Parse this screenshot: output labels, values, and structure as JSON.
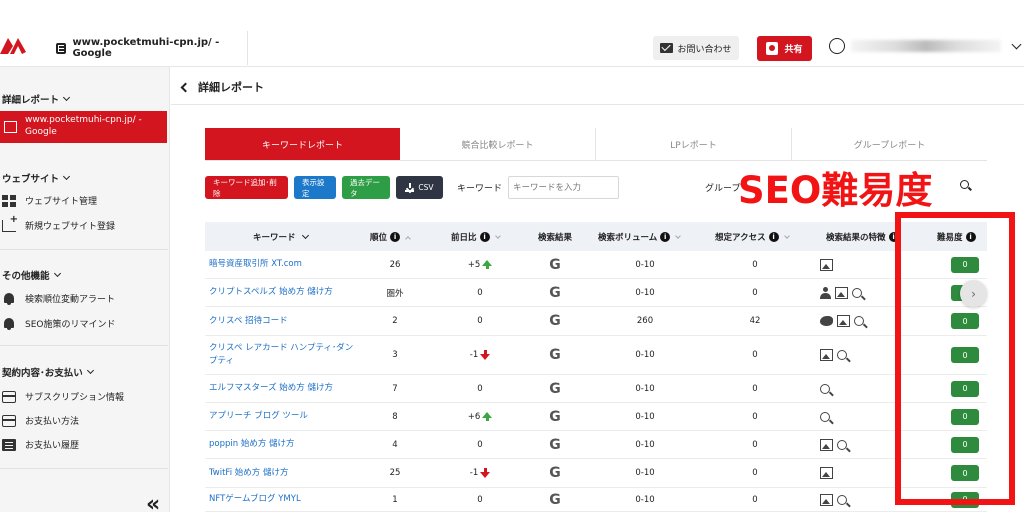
{
  "header": {
    "site_label": "www.pocketmuhi-cpn.jp/ - Google",
    "contact_label": "お問い合わせ",
    "share_label": "共有"
  },
  "sidebar": {
    "report_title": "詳細レポート",
    "active_site": "www.pocketmuhi-cpn.jp/ - Google",
    "website_title": "ウェブサイト",
    "website_items": [
      "ウェブサイト管理",
      "新規ウェブサイト登録"
    ],
    "other_title": "その他機能",
    "other_items": [
      "検索順位変動アラート",
      "SEO施策のリマインド"
    ],
    "contract_title": "契約内容･お支払い",
    "contract_items": [
      "サブスクリプション情報",
      "お支払い方法",
      "お支払い履歴"
    ],
    "collapse_icon": "«"
  },
  "main": {
    "page_title": "詳細レポート",
    "tabs": [
      "キーワードレポート",
      "競合比較レポート",
      "LPレポート",
      "グループレポート"
    ],
    "toolbar": {
      "add_delete": "キーワード追加･削除",
      "display": "表示設定",
      "past_data": "過去データ",
      "csv": "CSV",
      "keyword_label": "キーワード",
      "keyword_placeholder": "キーワードを入力",
      "group_label": "グループ"
    },
    "overlay_title": "SEO難易度",
    "table": {
      "headers": {
        "keyword": "キーワード",
        "rank": "順位",
        "diff": "前日比",
        "result": "検索結果",
        "volume": "検索ボリューム",
        "access": "想定アクセス",
        "features": "検索結果の特徴",
        "seo": "難易度"
      },
      "rows": [
        {
          "keyword": "暗号資産取引所 XT.com",
          "rank": "26",
          "diff": "+5",
          "trend": "up",
          "g": "G",
          "volume": "0-10",
          "access": "0",
          "features": [
            "image"
          ],
          "seo": "0"
        },
        {
          "keyword": "クリプトスペルズ 始め方 儲け方",
          "rank": "圏外",
          "diff": "0",
          "trend": "",
          "g": "G",
          "volume": "0-10",
          "access": "0",
          "features": [
            "person",
            "image",
            "search"
          ],
          "seo": "0"
        },
        {
          "keyword": "クリスペ 招待コード",
          "rank": "2",
          "diff": "0",
          "trend": "",
          "g": "G",
          "volume": "260",
          "access": "42",
          "features": [
            "twitter",
            "image",
            "search"
          ],
          "seo": "0"
        },
        {
          "keyword": "クリスペ レアカード ハンプティ･ダンプティ",
          "rank": "3",
          "diff": "-1",
          "trend": "down",
          "g": "G",
          "volume": "0-10",
          "access": "0",
          "features": [
            "image",
            "search"
          ],
          "seo": "0"
        },
        {
          "keyword": "エルフマスターズ 始め方 儲け方",
          "rank": "7",
          "diff": "0",
          "trend": "",
          "g": "G",
          "volume": "0-10",
          "access": "0",
          "features": [
            "search"
          ],
          "seo": "0"
        },
        {
          "keyword": "アプリーチ ブログ ツール",
          "rank": "8",
          "diff": "+6",
          "trend": "up",
          "g": "G",
          "volume": "0-10",
          "access": "0",
          "features": [
            "search"
          ],
          "seo": "0"
        },
        {
          "keyword": "poppin 始め方 儲け方",
          "rank": "4",
          "diff": "0",
          "trend": "",
          "g": "G",
          "volume": "0-10",
          "access": "0",
          "features": [
            "image",
            "search"
          ],
          "seo": "0"
        },
        {
          "keyword": "TwitFi 始め方 儲け方",
          "rank": "25",
          "diff": "-1",
          "trend": "down",
          "g": "G",
          "volume": "0-10",
          "access": "0",
          "features": [
            "image"
          ],
          "seo": "0"
        },
        {
          "keyword": "NFTゲームブログ YMYL",
          "rank": "1",
          "diff": "0",
          "trend": "",
          "g": "G",
          "volume": "0-10",
          "access": "0",
          "features": [
            "image",
            "search"
          ],
          "seo": "0"
        }
      ]
    },
    "float_button": "›"
  },
  "colors": {
    "brand_red": "#d3151f",
    "overlay_red": "#f21414",
    "seo_green": "#2e8b3e",
    "link_blue": "#1c6fc7"
  }
}
